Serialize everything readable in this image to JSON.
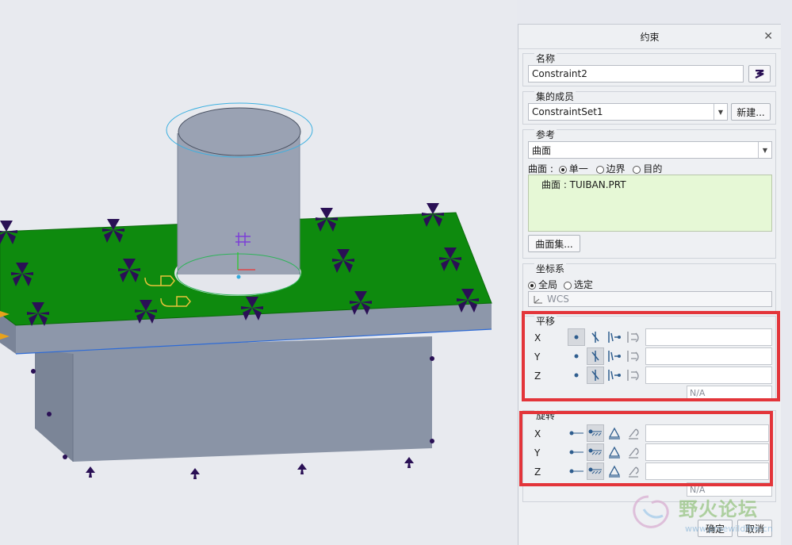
{
  "dialog": {
    "title": "约束",
    "name_label": "名称",
    "name_value": "Constraint2",
    "set_label": "集的成员",
    "set_value": "ConstraintSet1",
    "new_button": "新建...",
    "ref_label": "参考",
    "ref_type": "曲面",
    "surface_prefix": "曲面 :",
    "radio_single": "单一",
    "radio_boundary": "边界",
    "radio_intent": "目的",
    "ref_item": "曲面 : TUIBAN.PRT",
    "surface_set_button": "曲面集...",
    "cs_label": "坐标系",
    "radio_global": "全局",
    "radio_selected": "选定",
    "cs_value": "WCS",
    "translation_label": "平移",
    "rotation_label": "旋转",
    "axes": [
      "X",
      "Y",
      "Z"
    ],
    "na_text": "N/A",
    "ok_button": "确定",
    "cancel_button": "取消"
  },
  "watermark": {
    "text": "野火论坛",
    "url": "www.proewildfire.cn"
  },
  "colors": {
    "plate": "#0e8a0e",
    "body": "#8a94a6",
    "highlight": "#e3353a",
    "constraint_symbol": "#2a1055"
  }
}
